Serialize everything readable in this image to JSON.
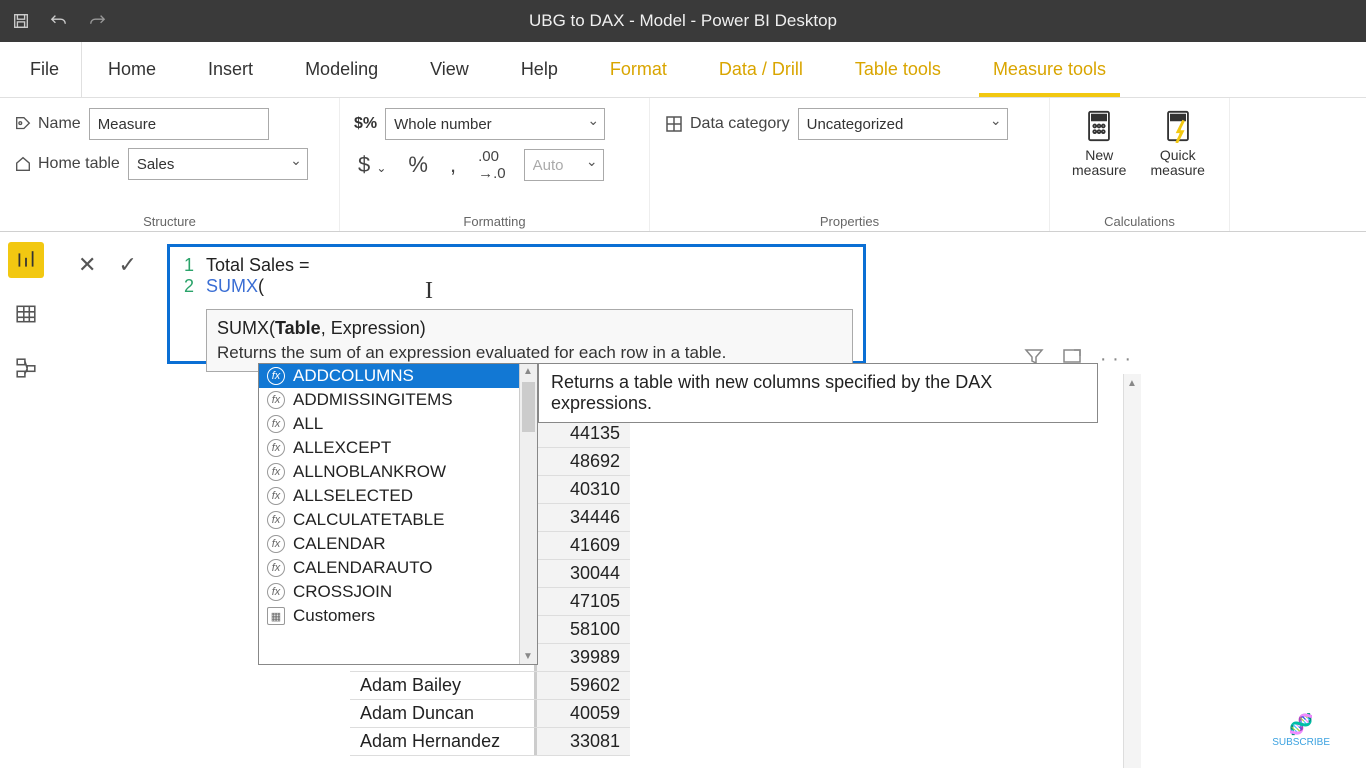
{
  "titlebar": {
    "title": "UBG to DAX - Model - Power BI Desktop"
  },
  "menu": {
    "file": "File",
    "items": [
      "Home",
      "Insert",
      "Modeling",
      "View",
      "Help",
      "Format",
      "Data / Drill",
      "Table tools",
      "Measure tools"
    ],
    "accent_indices": [
      5,
      6,
      7,
      8
    ],
    "active_index": 8
  },
  "ribbon": {
    "structure": {
      "label": "Structure",
      "name_label": "Name",
      "name_value": "Measure",
      "home_label": "Home table",
      "home_value": "Sales"
    },
    "formatting": {
      "label": "Formatting",
      "type_value": "Whole number",
      "auto_placeholder": "Auto"
    },
    "properties": {
      "label": "Properties",
      "category_label": "Data category",
      "category_value": "Uncategorized"
    },
    "calculations": {
      "label": "Calculations",
      "new_measure": "New measure",
      "quick_measure": "Quick measure"
    }
  },
  "formula": {
    "line1_text": "Total Sales =",
    "line2_fn": "SUMX",
    "line2_rest": "(",
    "tooltip_sig_pre": "SUMX(",
    "tooltip_sig_bold": "Table",
    "tooltip_sig_post": ", Expression)",
    "tooltip_desc": "Returns the sum of an expression evaluated for each row in a table."
  },
  "intellisense": {
    "items": [
      {
        "name": "ADDCOLUMNS",
        "type": "fn",
        "selected": true
      },
      {
        "name": "ADDMISSINGITEMS",
        "type": "fn"
      },
      {
        "name": "ALL",
        "type": "fn"
      },
      {
        "name": "ALLEXCEPT",
        "type": "fn"
      },
      {
        "name": "ALLNOBLANKROW",
        "type": "fn"
      },
      {
        "name": "ALLSELECTED",
        "type": "fn"
      },
      {
        "name": "CALCULATETABLE",
        "type": "fn"
      },
      {
        "name": "CALENDAR",
        "type": "fn"
      },
      {
        "name": "CALENDARAUTO",
        "type": "fn"
      },
      {
        "name": "CROSSJOIN",
        "type": "fn"
      },
      {
        "name": "Customers",
        "type": "table"
      }
    ],
    "description": "Returns a table with new columns specified by the DAX expressions."
  },
  "table": {
    "rows": [
      {
        "name": "",
        "value": "44135"
      },
      {
        "name": "",
        "value": "48692"
      },
      {
        "name": "",
        "value": "40310"
      },
      {
        "name": "",
        "value": "34446"
      },
      {
        "name": "",
        "value": "41609"
      },
      {
        "name": "",
        "value": "30044"
      },
      {
        "name": "",
        "value": "47105"
      },
      {
        "name": "",
        "value": "58100"
      },
      {
        "name": "",
        "value": "39989"
      },
      {
        "name": "Adam Bailey",
        "value": "59602"
      },
      {
        "name": "Adam Duncan",
        "value": "40059"
      },
      {
        "name": "Adam Hernandez",
        "value": "33081"
      }
    ]
  },
  "subscribe": {
    "label": "SUBSCRIBE"
  }
}
